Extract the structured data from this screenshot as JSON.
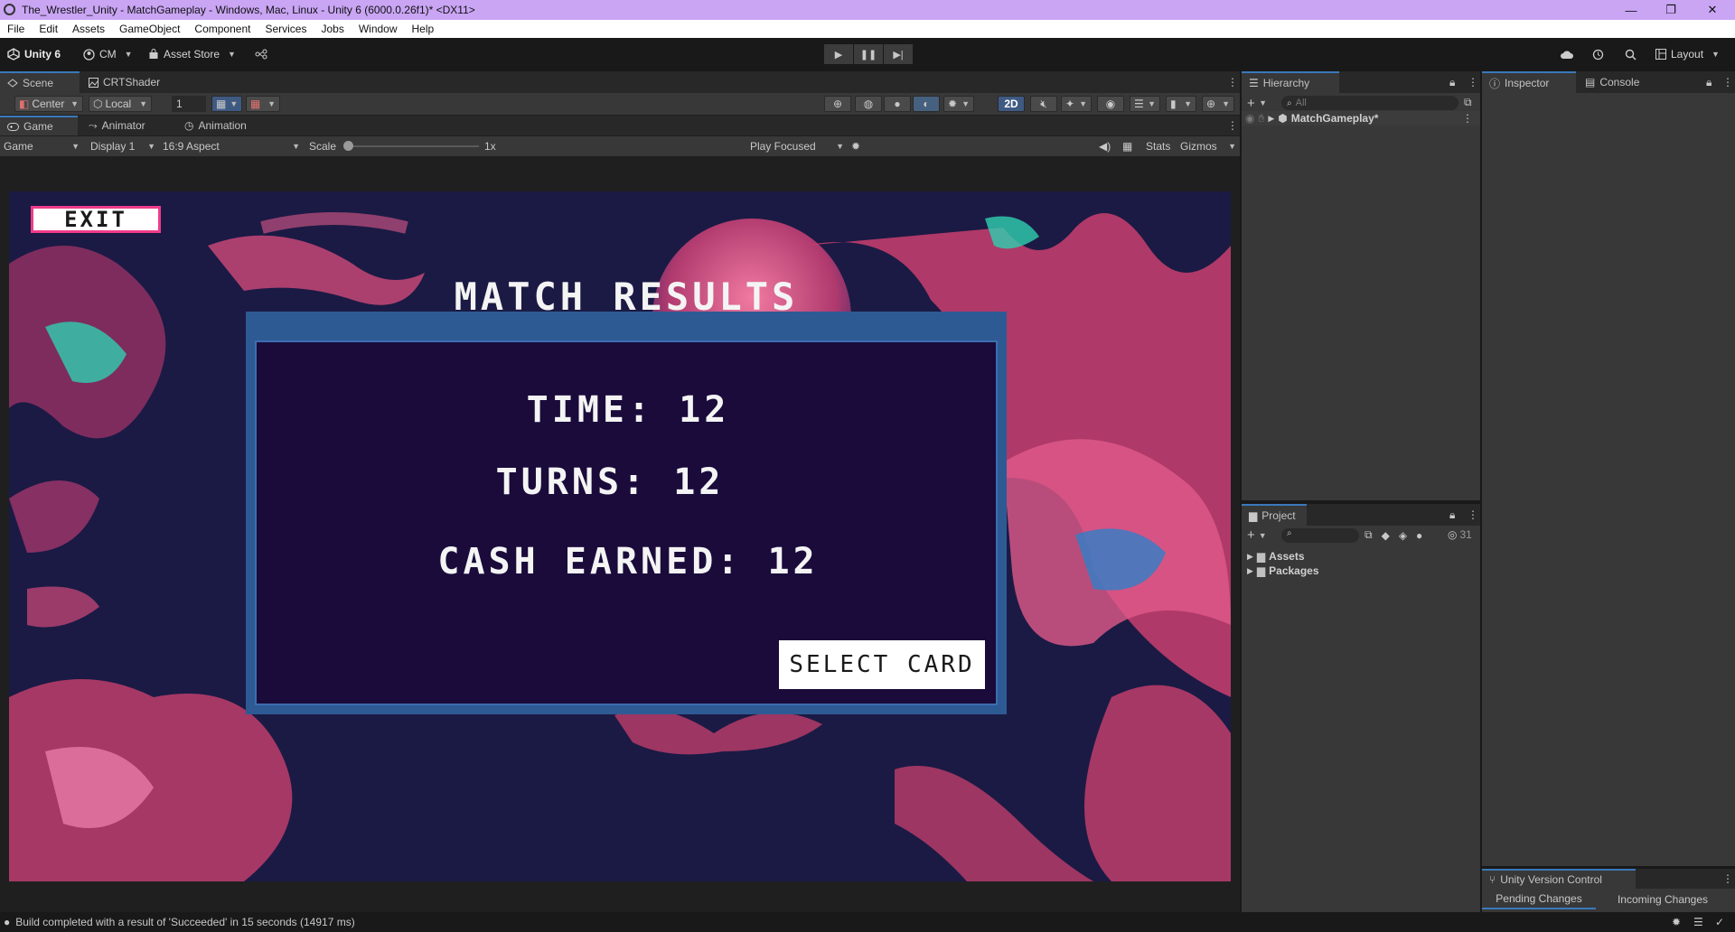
{
  "window": {
    "title": "The_Wrestler_Unity - MatchGameplay - Windows, Mac, Linux - Unity 6 (6000.0.26f1)* <DX11>",
    "controls": [
      "—",
      "❐",
      "✕"
    ]
  },
  "menu": [
    "File",
    "Edit",
    "Assets",
    "GameObject",
    "Component",
    "Services",
    "Jobs",
    "Window",
    "Help"
  ],
  "toolbar": {
    "unity_label": "Unity 6",
    "account_label": "CM",
    "asset_store_label": "Asset Store",
    "layout_label": "Layout"
  },
  "scene_tabs": [
    "Scene",
    "CRTShader"
  ],
  "scene_toolbar": {
    "pivot": "Center",
    "space": "Local",
    "snap_value": "1",
    "mode_2d": "2D"
  },
  "game_tabs": [
    "Game",
    "Animator",
    "Animation"
  ],
  "game_bar": {
    "view": "Game",
    "display": "Display 1",
    "aspect": "16:9 Aspect",
    "scale_label": "Scale",
    "scale_value": "1x",
    "play_mode": "Play Focused",
    "stats": "Stats",
    "gizmos": "Gizmos"
  },
  "game": {
    "exit_label": "EXIT",
    "results_title": "MATCH RESULTS",
    "time_line": "TIME: 12",
    "turns_line": "TURNS: 12",
    "cash_line": "CASH EARNED: 12",
    "select_label": "SELECT CARD"
  },
  "hierarchy": {
    "tab": "Hierarchy",
    "search_placeholder": "All",
    "scene_name": "MatchGameplay*"
  },
  "inspector_tabs": [
    "Inspector",
    "Console"
  ],
  "project": {
    "tab": "Project",
    "hidden_count": "31",
    "folders": [
      "Assets",
      "Packages"
    ]
  },
  "version_control": {
    "title": "Unity Version Control",
    "tabs": [
      "Pending Changes",
      "Incoming Changes"
    ]
  },
  "status": {
    "message": "Build completed with a result of 'Succeeded' in 15 seconds (14917 ms)"
  },
  "colors": {
    "title_bar": "#c9a5f4",
    "accent": "#3a79bb",
    "game_panel_frame": "#2e5a94",
    "game_panel_bg": "#1a0b3b",
    "exit_border": "#f03b8a"
  }
}
